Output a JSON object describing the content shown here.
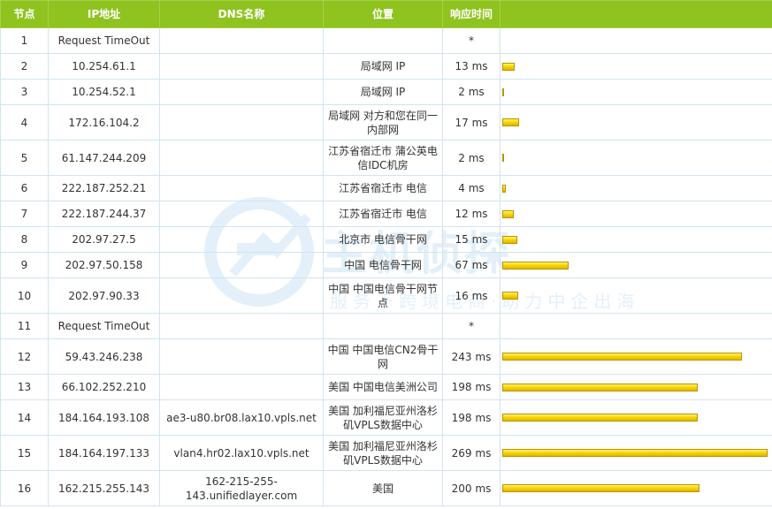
{
  "table": {
    "headers": {
      "node": "节点",
      "ip": "IP地址",
      "dns": "DNS名称",
      "location": "位置",
      "time": "响应时间",
      "bar": ""
    },
    "rows": [
      {
        "node": "1",
        "ip": "Request TimeOut",
        "dns": "",
        "location": "",
        "time": "*",
        "ms": 0
      },
      {
        "node": "2",
        "ip": "10.254.61.1",
        "dns": "",
        "location": "局域网 IP",
        "time": "13 ms",
        "ms": 13
      },
      {
        "node": "3",
        "ip": "10.254.52.1",
        "dns": "",
        "location": "局域网 IP",
        "time": "2 ms",
        "ms": 2
      },
      {
        "node": "4",
        "ip": "172.16.104.2",
        "dns": "",
        "location": "局域网 对方和您在同一内部网",
        "time": "17 ms",
        "ms": 17
      },
      {
        "node": "5",
        "ip": "61.147.244.209",
        "dns": "",
        "location": "江苏省宿迁市 蒲公英电信IDC机房",
        "time": "2 ms",
        "ms": 2
      },
      {
        "node": "6",
        "ip": "222.187.252.21",
        "dns": "",
        "location": "江苏省宿迁市 电信",
        "time": "4 ms",
        "ms": 4
      },
      {
        "node": "7",
        "ip": "222.187.244.37",
        "dns": "",
        "location": "江苏省宿迁市 电信",
        "time": "12 ms",
        "ms": 12
      },
      {
        "node": "8",
        "ip": "202.97.27.5",
        "dns": "",
        "location": "北京市 电信骨干网",
        "time": "15 ms",
        "ms": 15
      },
      {
        "node": "9",
        "ip": "202.97.50.158",
        "dns": "",
        "location": "中国 电信骨干网",
        "time": "67 ms",
        "ms": 67
      },
      {
        "node": "10",
        "ip": "202.97.90.33",
        "dns": "",
        "location": "中国 中国电信骨干网节点",
        "time": "16 ms",
        "ms": 16
      },
      {
        "node": "11",
        "ip": "Request TimeOut",
        "dns": "",
        "location": "",
        "time": "*",
        "ms": 0
      },
      {
        "node": "12",
        "ip": "59.43.246.238",
        "dns": "",
        "location": "中国 中国电信CN2骨干网",
        "time": "243 ms",
        "ms": 243
      },
      {
        "node": "13",
        "ip": "66.102.252.210",
        "dns": "",
        "location": "美国 中国电信美洲公司",
        "time": "198 ms",
        "ms": 198
      },
      {
        "node": "14",
        "ip": "184.164.193.108",
        "dns": "ae3-u80.br08.lax10.vpls.net",
        "location": "美国 加利福尼亚州洛杉矶VPLS数据中心",
        "time": "198 ms",
        "ms": 198
      },
      {
        "node": "15",
        "ip": "184.164.197.133",
        "dns": "vlan4.hr02.lax10.vpls.net",
        "location": "美国 加利福尼亚州洛杉矶VPLS数据中心",
        "time": "269 ms",
        "ms": 269
      },
      {
        "node": "16",
        "ip": "162.215.255.143",
        "dns": "162-215-255-143.unifiedlayer.com",
        "location": "美国",
        "time": "200 ms",
        "ms": 200
      }
    ],
    "colors": {
      "header_bg": "#8fc31f",
      "border": "#d2e4ee",
      "bar_fill": "#f8d800"
    }
  },
  "watermark": {
    "brand": "主机侦探",
    "slogan": "服务于跨境电商·助力中企出海"
  }
}
